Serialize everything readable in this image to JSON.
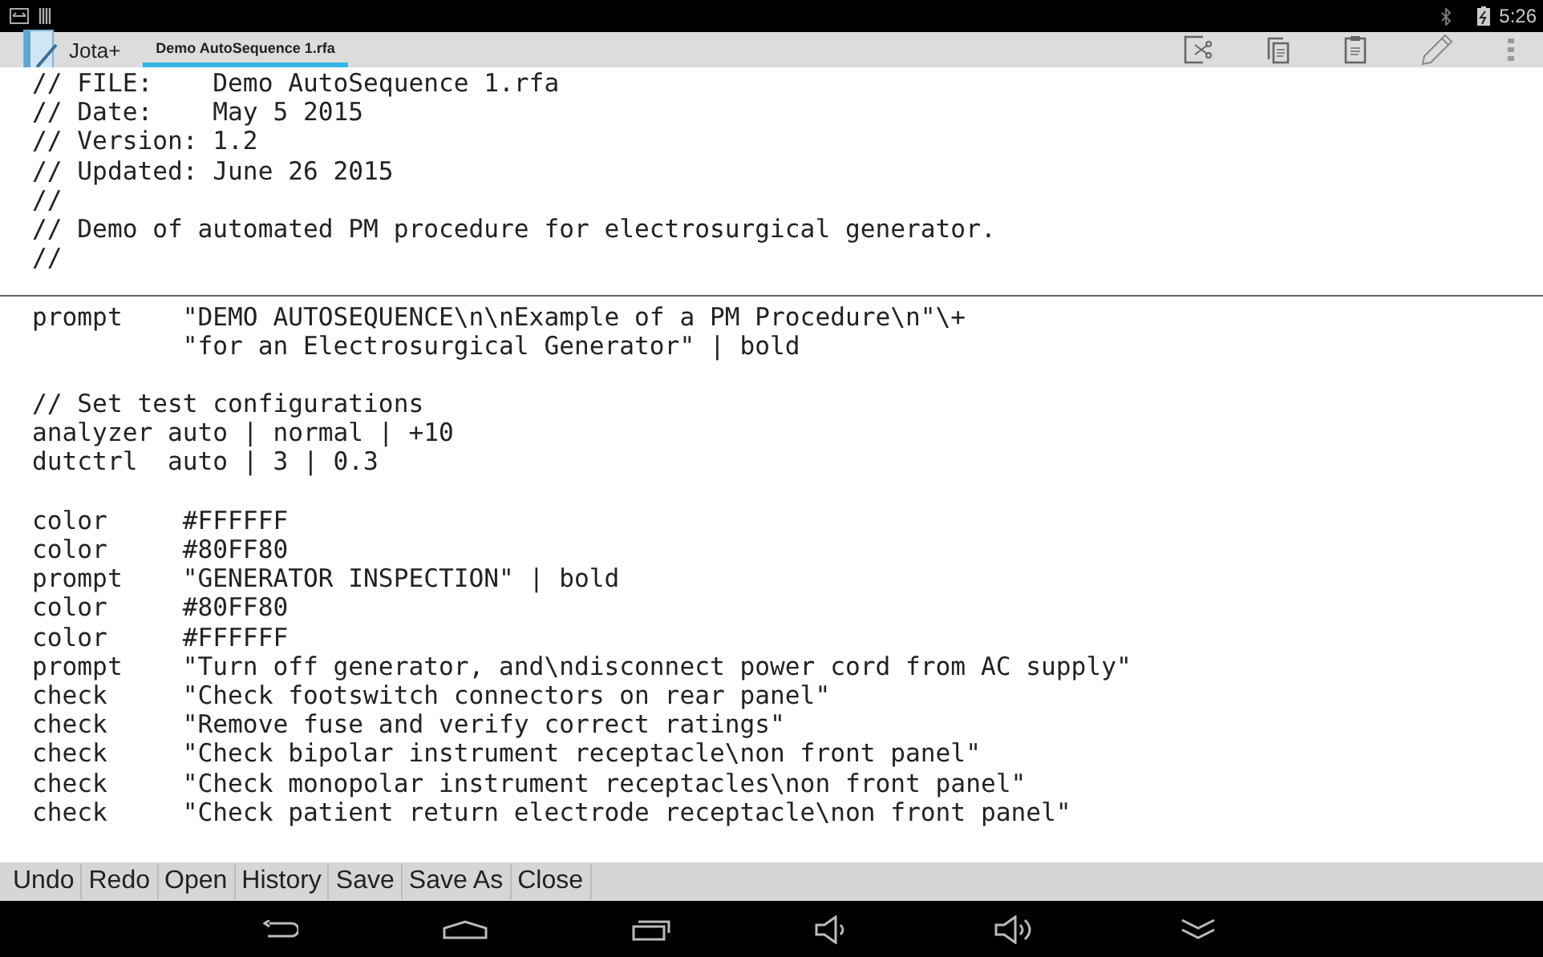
{
  "status_bar": {
    "time": "5:26"
  },
  "app_bar": {
    "app_name": "Jota+",
    "tabs": [
      {
        "label": "Demo AutoSequence 1.rfa",
        "selected": true
      }
    ]
  },
  "editor": {
    "header_lines": [
      "// FILE:    Demo AutoSequence 1.rfa",
      "// Date:    May 5 2015",
      "// Version: 1.2",
      "// Updated: June 26 2015",
      "//",
      "// Demo of automated PM procedure for electrosurgical generator.",
      "//"
    ],
    "body_blocks": [
      [
        "prompt    \"DEMO AUTOSEQUENCE\\n\\nExample of a PM Procedure\\n\"\\+",
        "          \"for an Electrosurgical Generator\" | bold"
      ],
      [
        "// Set test configurations",
        "analyzer auto | normal | +10",
        "dutctrl  auto | 3 | 0.3"
      ],
      [
        "color     #FFFFFF",
        "color     #80FF80",
        "prompt    \"GENERATOR INSPECTION\" | bold",
        "color     #80FF80",
        "color     #FFFFFF",
        "prompt    \"Turn off generator, and\\ndisconnect power cord from AC supply\"",
        "check     \"Check footswitch connectors on rear panel\"",
        "check     \"Remove fuse and verify correct ratings\"",
        "check     \"Check bipolar instrument receptacle\\non front panel\"",
        "check     \"Check monopolar instrument receptacles\\non front panel\"",
        "check     \"Check patient return electrode receptacle\\non front panel\""
      ]
    ]
  },
  "bottom_toolbar": [
    "Undo",
    "Redo",
    "Open",
    "History",
    "Save",
    "Save As",
    "Close"
  ]
}
